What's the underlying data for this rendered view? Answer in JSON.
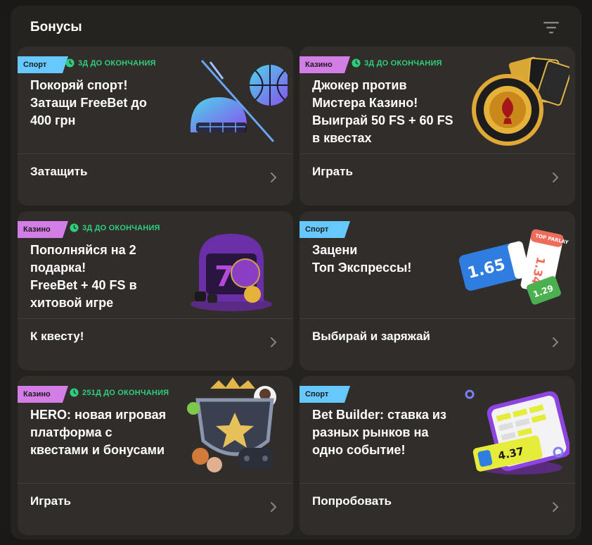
{
  "header": {
    "title": "Бонусы",
    "filter_icon": "filter-icon"
  },
  "colors": {
    "sport": "#66c8ff",
    "casino": "#d37de6",
    "deadline": "#2ecf7c"
  },
  "cards": [
    {
      "tag": "Спорт",
      "deadline": "3Д ДО ОКОНЧАНИЯ",
      "title": "Покоряй спорт!\nЗатащи FreeBet до\n400 грн",
      "action": "Затащить",
      "art": "hockey-helmet-basketball-art"
    },
    {
      "tag": "Казино",
      "deadline": "3Д ДО ОКОНЧАНИЯ",
      "title": "Джокер против\nМистера Казино!\nВыиграй 50 FS + 60 FS\nв квестах",
      "action": "Играть",
      "art": "casino-chip-cards-art"
    },
    {
      "tag": "Казино",
      "deadline": "3Д ДО ОКОНЧАНИЯ",
      "title": "Пополняйся на 2\nподарка!\nFreeBet + 40 FS в\nхитовой игре",
      "action": "К квесту!",
      "art": "slot-machine-ball-art"
    },
    {
      "tag": "Спорт",
      "deadline": "",
      "title": "Зацени\nТоп Экспрессы!",
      "action": "Выбирай и заряжай",
      "art": "parlay-tickets-art"
    },
    {
      "tag": "Казино",
      "deadline": "251Д ДО ОКОНЧАНИЯ",
      "title": "HERO: новая игровая\nплатформа с\nквестами и бонусами",
      "action": "Играть",
      "art": "hero-shield-art"
    },
    {
      "tag": "Спорт",
      "deadline": "",
      "title": "Bet Builder: ставка из\nразных рынков на\nодно событие!",
      "action": "Попробовать",
      "art": "phone-bet-builder-art"
    }
  ],
  "art_text": {
    "ticket1": "1.65",
    "ticket2": "1.34",
    "ticket3": "1.29",
    "top_parlay": "TOP PARLAY",
    "phone_odds": "4.37"
  }
}
